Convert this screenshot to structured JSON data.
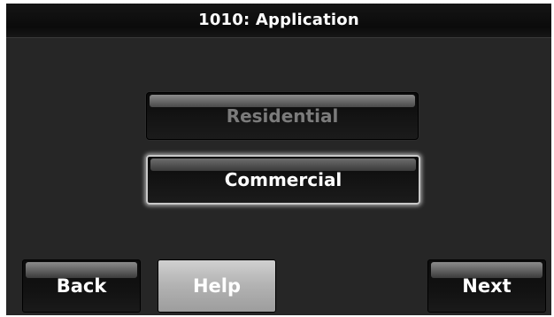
{
  "title_bar": {
    "title": "1010: Application"
  },
  "options": {
    "residential_label": "Residential",
    "commercial_label": "Commercial",
    "selected": "Commercial"
  },
  "nav": {
    "back_label": "Back",
    "help_label": "Help",
    "next_label": "Next"
  },
  "colors": {
    "screen_bg": "#262626",
    "title_bar_bg": "#0b0b0b",
    "disabled_text": "#7b7b7b",
    "selected_glow": "#c8c8c8",
    "help_button_bg": "#b4b4b4"
  }
}
